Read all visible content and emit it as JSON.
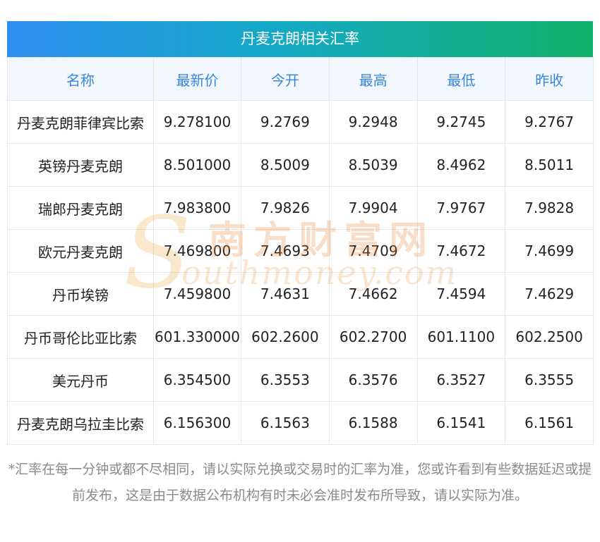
{
  "title": "丹麦克朗相关汇率",
  "headers": [
    "名称",
    "最新价",
    "今开",
    "最高",
    "最低",
    "昨收"
  ],
  "rows": [
    [
      "丹麦克朗菲律宾比索",
      "9.278100",
      "9.2769",
      "9.2948",
      "9.2745",
      "9.2767"
    ],
    [
      "英镑丹麦克朗",
      "8.501000",
      "8.5009",
      "8.5039",
      "8.4962",
      "8.5011"
    ],
    [
      "瑞郎丹麦克朗",
      "7.983800",
      "7.9826",
      "7.9904",
      "7.9767",
      "7.9828"
    ],
    [
      "欧元丹麦克朗",
      "7.469800",
      "7.4693",
      "7.4709",
      "7.4672",
      "7.4699"
    ],
    [
      "丹币埃镑",
      "7.459800",
      "7.4631",
      "7.4662",
      "7.4594",
      "7.4629"
    ],
    [
      "丹币哥伦比亚比索",
      "601.330000",
      "602.2600",
      "602.2700",
      "601.1100",
      "602.2500"
    ],
    [
      "美元丹币",
      "6.354500",
      "6.3553",
      "6.3576",
      "6.3527",
      "6.3555"
    ],
    [
      "丹麦克朗乌拉圭比索",
      "6.156300",
      "6.1563",
      "6.1588",
      "6.1541",
      "6.1561"
    ]
  ],
  "note": "*汇率在每一分钟或都不尽相同，请以实际兑换或交易时的汇率为准，您或许看到有些数据延迟或提前发布，这是由于数据公布机构有时未必会准时发布所导致，请以实际为准。",
  "watermark": {
    "cn": "南方财富网",
    "en": "outhmoney.com",
    "letter": "S"
  },
  "colors": {
    "header_gradient_start": "#2f8ff0",
    "header_gradient_end": "#11b36a",
    "column_header_text": "#3a86dd",
    "column_header_bg": "#f2f7fd"
  }
}
